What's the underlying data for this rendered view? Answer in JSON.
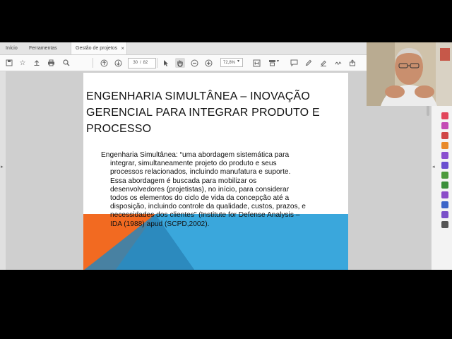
{
  "tabs": [
    {
      "label": "Início"
    },
    {
      "label": "Ferramentas"
    },
    {
      "label": "Gestão de projetos ..."
    }
  ],
  "toolbar": {
    "current_page": "30",
    "page_separator": "/",
    "total_pages": "82",
    "zoom": "72,8%"
  },
  "slide": {
    "title_lines": [
      "ENGENHARIA SIMULTÂNEA – INOVAÇÃO",
      "GERENCIAL PARA INTEGRAR PRODUTO E",
      "PROCESSO"
    ],
    "body_lines": [
      "Engenharia Simultânea: “uma abordagem sistemática para",
      "integrar, simultaneamente projeto do produto e seus",
      "processos relacionados, incluindo manufatura e suporte.",
      "Essa abordagem é buscada para mobilizar os",
      "desenvolvedores (projetistas), no início, para considerar",
      "todos os elementos do ciclo de vida da concepção até a",
      "disposição, incluindo controle da qualidade, custos, prazos, e",
      "necessidades dos clientes” (Institute for Defense Analysis –",
      "IDA (1988) apud (SCPD,2002)."
    ],
    "colors": {
      "orange": "#f26a21",
      "blue": "#3aa7dc",
      "dark_blue": "#2a85b8"
    }
  },
  "icons": {
    "save": "save-icon",
    "bookmark": "star-icon",
    "upload": "upload-icon",
    "print": "print-icon",
    "search": "search-icon",
    "prev_page": "arrow-up-icon",
    "next_page": "arrow-down-icon",
    "select": "cursor-icon",
    "hand": "hand-icon",
    "zoom_out": "zoom-out-icon",
    "zoom_in": "zoom-in-icon"
  }
}
